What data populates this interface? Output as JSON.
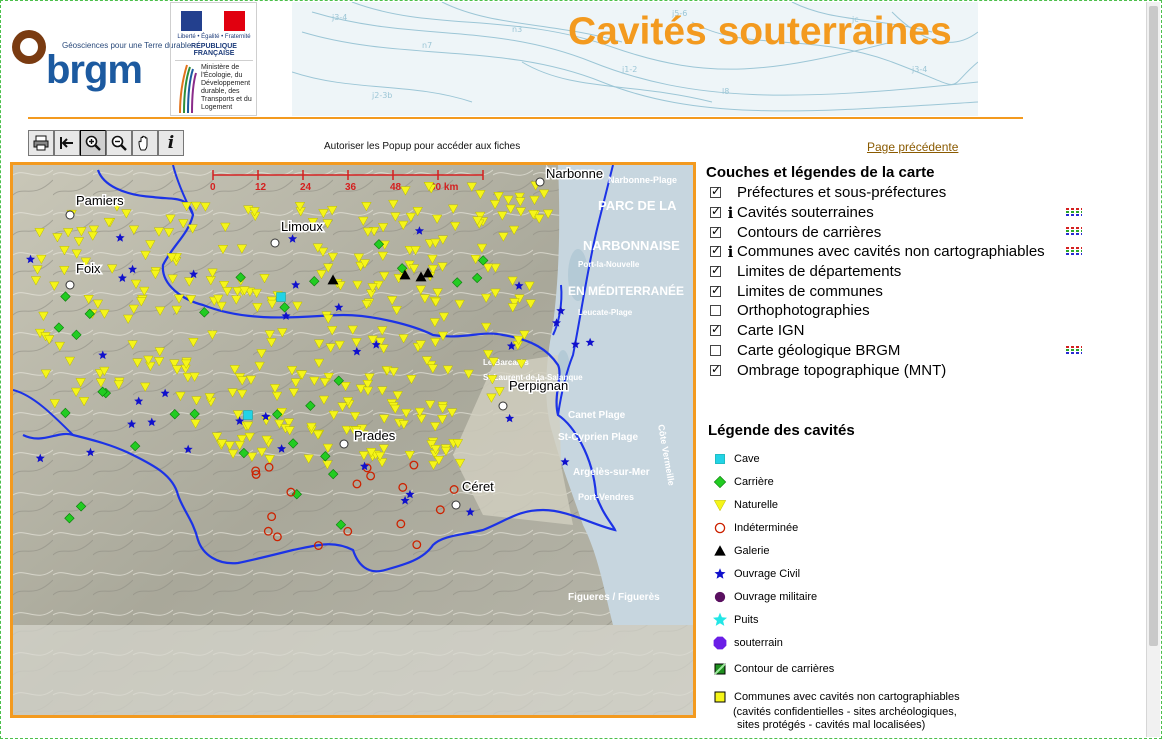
{
  "header": {
    "brgm_tagline": "Géosciences pour une Terre durable",
    "brgm_name": "brgm",
    "rf_motto": "Liberté • Égalité • Fraternité",
    "rf_name": "RÉPUBLIQUE FRANÇAISE",
    "ministry": "Ministère de l'Écologie, du Développement durable, des Transports et du Logement",
    "title": "Cavités souterraines",
    "accent_color": "#f39a1f",
    "brgm_color": "#1c5aa0"
  },
  "toolbar": {
    "tools": [
      {
        "name": "print-icon",
        "label": "🖶"
      },
      {
        "name": "back-icon",
        "label": "↤"
      },
      {
        "name": "zoom-in-icon",
        "label": "+"
      },
      {
        "name": "zoom-out-icon",
        "label": "−"
      },
      {
        "name": "pan-hand-icon",
        "label": "✋"
      },
      {
        "name": "info-icon",
        "label": "i"
      }
    ],
    "popup_note": "Autoriser les Popup pour accéder aux fiches",
    "prev_link": "Page précédente"
  },
  "map": {
    "scale_labels": [
      "0",
      "12",
      "24",
      "36",
      "48",
      "60 km"
    ],
    "places": [
      {
        "name": "Narbonne"
      },
      {
        "name": "Pamiers"
      },
      {
        "name": "Limoux"
      },
      {
        "name": "Foix"
      },
      {
        "name": "Perpignan"
      },
      {
        "name": "Prades"
      },
      {
        "name": "Céret"
      }
    ],
    "basemap_labels": [
      "PARC DE LA",
      "NARBONNAISE",
      "EN MÉDITERRANÉE",
      "Narbonne-Plage",
      "Canet Plage",
      "St-Cyprien Plage",
      "Argelès-sur-Mer",
      "Port-Vendres",
      "Figueres / Figuerès",
      "Côte Vermeille",
      "St-Laurent-de-la-Salanque",
      "Le Barcarès",
      "Port-la-Nouvelle",
      "Leucate-Plage"
    ]
  },
  "layers": {
    "title": "Couches et légendes de la carte",
    "items": [
      {
        "label": "Préfectures et sous-préfectures",
        "checked": true,
        "info": false,
        "legend": false
      },
      {
        "label": "Cavités souterraines",
        "checked": true,
        "info": true,
        "legend": true
      },
      {
        "label": "Contours de carrières",
        "checked": true,
        "info": false,
        "legend": true
      },
      {
        "label": "Communes avec cavités non cartographiables",
        "checked": true,
        "info": true,
        "legend": true
      },
      {
        "label": "Limites de départements",
        "checked": true,
        "info": false,
        "legend": false
      },
      {
        "label": "Limites de communes",
        "checked": true,
        "info": false,
        "legend": false
      },
      {
        "label": "Orthophotographies",
        "checked": false,
        "info": false,
        "legend": false
      },
      {
        "label": "Carte IGN",
        "checked": true,
        "info": false,
        "legend": false
      },
      {
        "label": "Carte géologique BRGM",
        "checked": false,
        "info": false,
        "legend": true
      },
      {
        "label": "Ombrage topographique (MNT)",
        "checked": true,
        "info": false,
        "legend": false
      }
    ]
  },
  "cavities": {
    "title": "Légende des cavités",
    "items": [
      {
        "label": "Cave",
        "symbol": "square",
        "color": "#22d3e6"
      },
      {
        "label": "Carrière",
        "symbol": "diamond",
        "color": "#22cc22"
      },
      {
        "label": "Naturelle",
        "symbol": "triangle-down",
        "color": "#f5f519"
      },
      {
        "label": "Indéterminée",
        "symbol": "ring",
        "color": "#cc2200"
      },
      {
        "label": "Galerie",
        "symbol": "triangle-up",
        "color": "#000000"
      },
      {
        "label": "Ouvrage Civil",
        "symbol": "star",
        "color": "#1010cc"
      },
      {
        "label": "Ouvrage militaire",
        "symbol": "circle",
        "color": "#5a1060"
      },
      {
        "label": "Puits",
        "symbol": "star-big",
        "color": "#22e6e6"
      },
      {
        "label": "souterrain",
        "symbol": "octagon",
        "color": "#6a1ee6"
      }
    ],
    "quarry_outline": "Contour de carrières",
    "communes_label": "Communes avec cavités non cartographiables",
    "communes_note_1": "(cavités confidentielles - sites archéologiques,",
    "communes_note_2": "sites protégés - cavités mal localisées)"
  }
}
